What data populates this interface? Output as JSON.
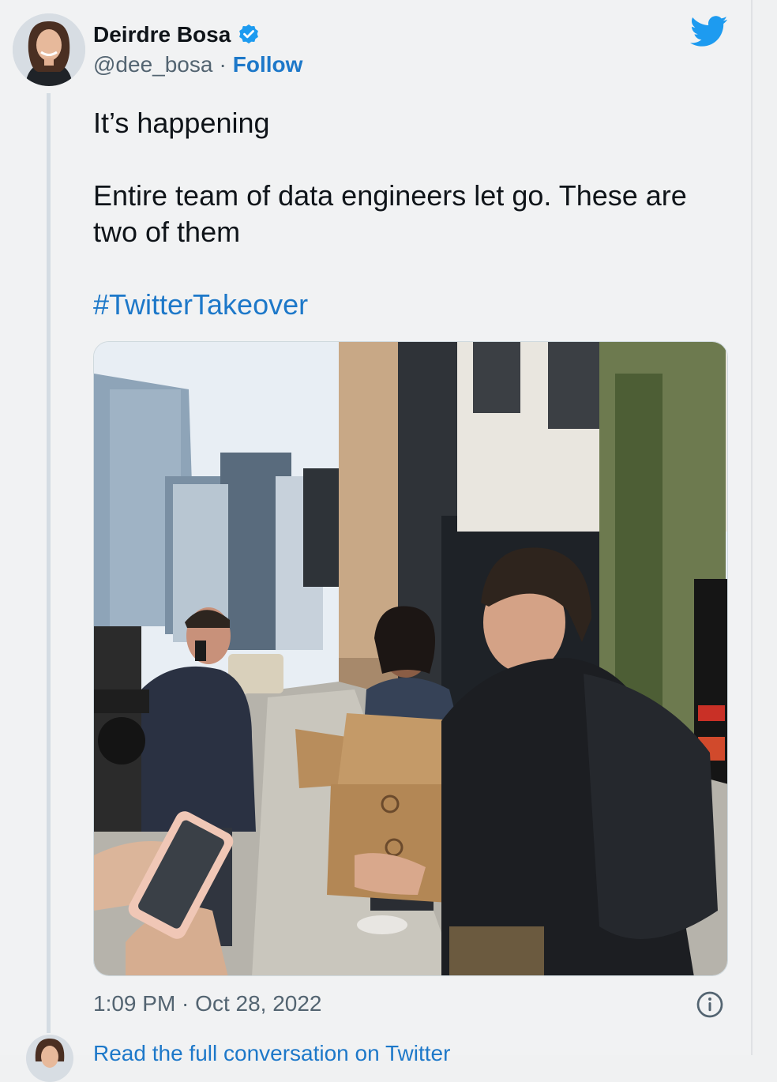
{
  "tweet": {
    "author": {
      "display_name": "Deirdre Bosa",
      "handle": "@dee_bosa",
      "separator": "·",
      "follow_label": "Follow",
      "avatar_icon": "profile-photo",
      "verified_icon": "verified-badge-icon"
    },
    "logo_icon": "twitter-bird-icon",
    "text_line1": "It’s happening",
    "text_line2": "Entire team of data engineers let go. These are two of them",
    "hashtag": "#TwitterTakeover",
    "media_icon": "street-photo",
    "timestamp": "1:09 PM · Oct 28, 2022",
    "info_icon": "info-icon",
    "read_more": "Read the full conversation on Twitter"
  },
  "colors": {
    "background": "#f1f2f3",
    "link": "#1d78c9",
    "text": "#0f1419",
    "muted": "#536471",
    "twitter_blue": "#1d9bf0"
  }
}
